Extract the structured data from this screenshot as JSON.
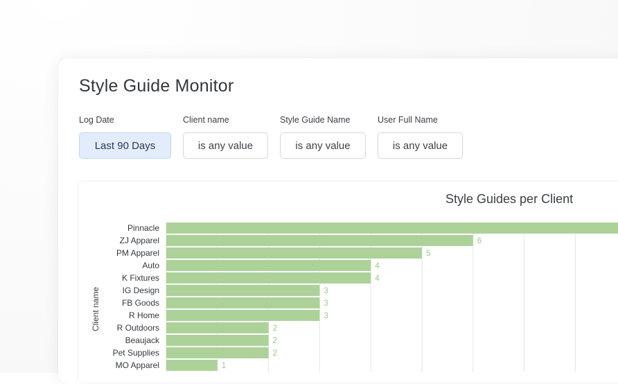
{
  "page": {
    "title": "Style Guide Monitor"
  },
  "filters": [
    {
      "label": "Log Date",
      "value": "Last 90 Days"
    },
    {
      "label": "Client name",
      "value": "is any value"
    },
    {
      "label": "Style Guide Name",
      "value": "is any value"
    },
    {
      "label": "User Full Name",
      "value": "is any value"
    }
  ],
  "colors": {
    "bar": "#acd29a",
    "data_label": "#9ccb88",
    "gridline": "#e6e6e6",
    "active_filter": "#e3ecfb"
  },
  "chart_data": {
    "type": "bar",
    "orientation": "horizontal",
    "title": "Style Guides per Client",
    "ylabel": "Client name",
    "xlabel": "",
    "xlim": [
      0,
      9
    ],
    "grid": true,
    "categories": [
      "Pinnacle",
      "ZJ Apparel",
      "PM Apparel",
      "Auto",
      "K Fixtures",
      "IG Design",
      "FB Goods",
      "R Home",
      "R Outdoors",
      "Beaujack",
      "Pet Supplies",
      "MO Apparel"
    ],
    "values": [
      9,
      6,
      5,
      4,
      4,
      3,
      3,
      3,
      2,
      2,
      2,
      1
    ],
    "data_labels": [
      "",
      "6",
      "5",
      "4",
      "4",
      "3",
      "3",
      "3",
      "2",
      "2",
      "2",
      "1"
    ]
  }
}
